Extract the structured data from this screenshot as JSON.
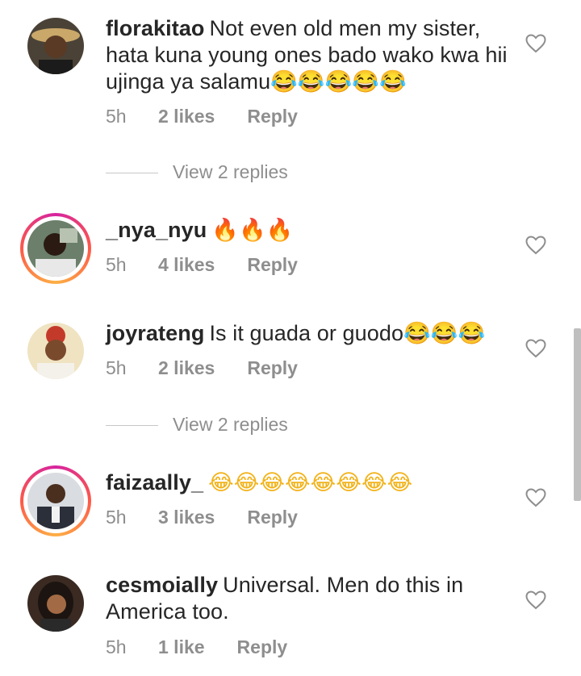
{
  "comments": [
    {
      "username": "florakitao",
      "text": "Not even old  men my sister, hata kuna young ones bado wako kwa hii ujinga ya salamu😂😂😂😂😂",
      "time": "5h",
      "likes": "2 likes",
      "reply": "Reply",
      "view_replies": "View 2 replies",
      "story_ring": false
    },
    {
      "username": "_nya_nyu",
      "text": "🔥🔥🔥",
      "time": "5h",
      "likes": "4 likes",
      "reply": "Reply",
      "story_ring": true
    },
    {
      "username": "joyrateng",
      "text": "Is it guada or guodo😂😂😂",
      "time": "5h",
      "likes": "2 likes",
      "reply": "Reply",
      "view_replies": "View 2 replies",
      "story_ring": false
    },
    {
      "username": "faizaally_",
      "text": "😂😂😂😂😂😂😂😂",
      "time": "5h",
      "likes": "3 likes",
      "reply": "Reply",
      "story_ring": true
    },
    {
      "username": "cesmoially",
      "text": "Universal.  Men do this in America too.",
      "time": "5h",
      "likes": "1 like",
      "reply": "Reply",
      "story_ring": false
    }
  ],
  "icons": {
    "like": "heart-outline-icon"
  },
  "colors": {
    "text": "#262626",
    "meta": "#8e8e8e",
    "ring_start": "#d6249f",
    "ring_end": "#fdb045"
  }
}
